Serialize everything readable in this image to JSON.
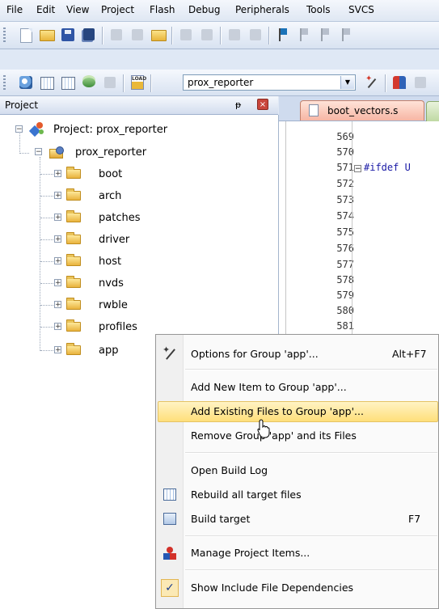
{
  "menubar": {
    "items": [
      "File",
      "Edit",
      "View",
      "Project",
      "Flash",
      "Debug",
      "Peripherals",
      "Tools",
      "SVCS"
    ]
  },
  "toolbar2": {
    "target_value": "prox_reporter",
    "load_label": "LOAD"
  },
  "project_panel": {
    "title": "Project",
    "pin": "ᵽ",
    "close": "×",
    "root_label": "Project: prox_reporter",
    "target_label": "prox_reporter",
    "groups": [
      "boot",
      "arch",
      "patches",
      "driver",
      "host",
      "nvds",
      "rwble",
      "profiles",
      "app"
    ]
  },
  "editor": {
    "tab_label": "boot_vectors.s",
    "line_numbers": [
      "569",
      "570",
      "571",
      "572",
      "573",
      "574",
      "575",
      "576",
      "577",
      "578",
      "579",
      "580",
      "581"
    ],
    "code_571": "#ifdef U"
  },
  "context_menu": {
    "options_label": "Options for Group 'app'...",
    "options_shortcut": "Alt+F7",
    "add_new_label": "Add New  Item to Group 'app'...",
    "add_existing_label": "Add Existing Files to Group 'app'...",
    "remove_label": "Remove Group 'app' and its Files",
    "open_log_label": "Open Build Log",
    "rebuild_label": "Rebuild all target files",
    "build_label": "Build target",
    "build_shortcut": "F7",
    "manage_label": "Manage Project Items...",
    "show_deps_label": "Show Include File Dependencies",
    "show_deps_check": "✓"
  },
  "colors": {
    "highlight": "#ffdf7a",
    "tab_active": "#f7b6a4",
    "code_blue": "#1a1aa6"
  }
}
